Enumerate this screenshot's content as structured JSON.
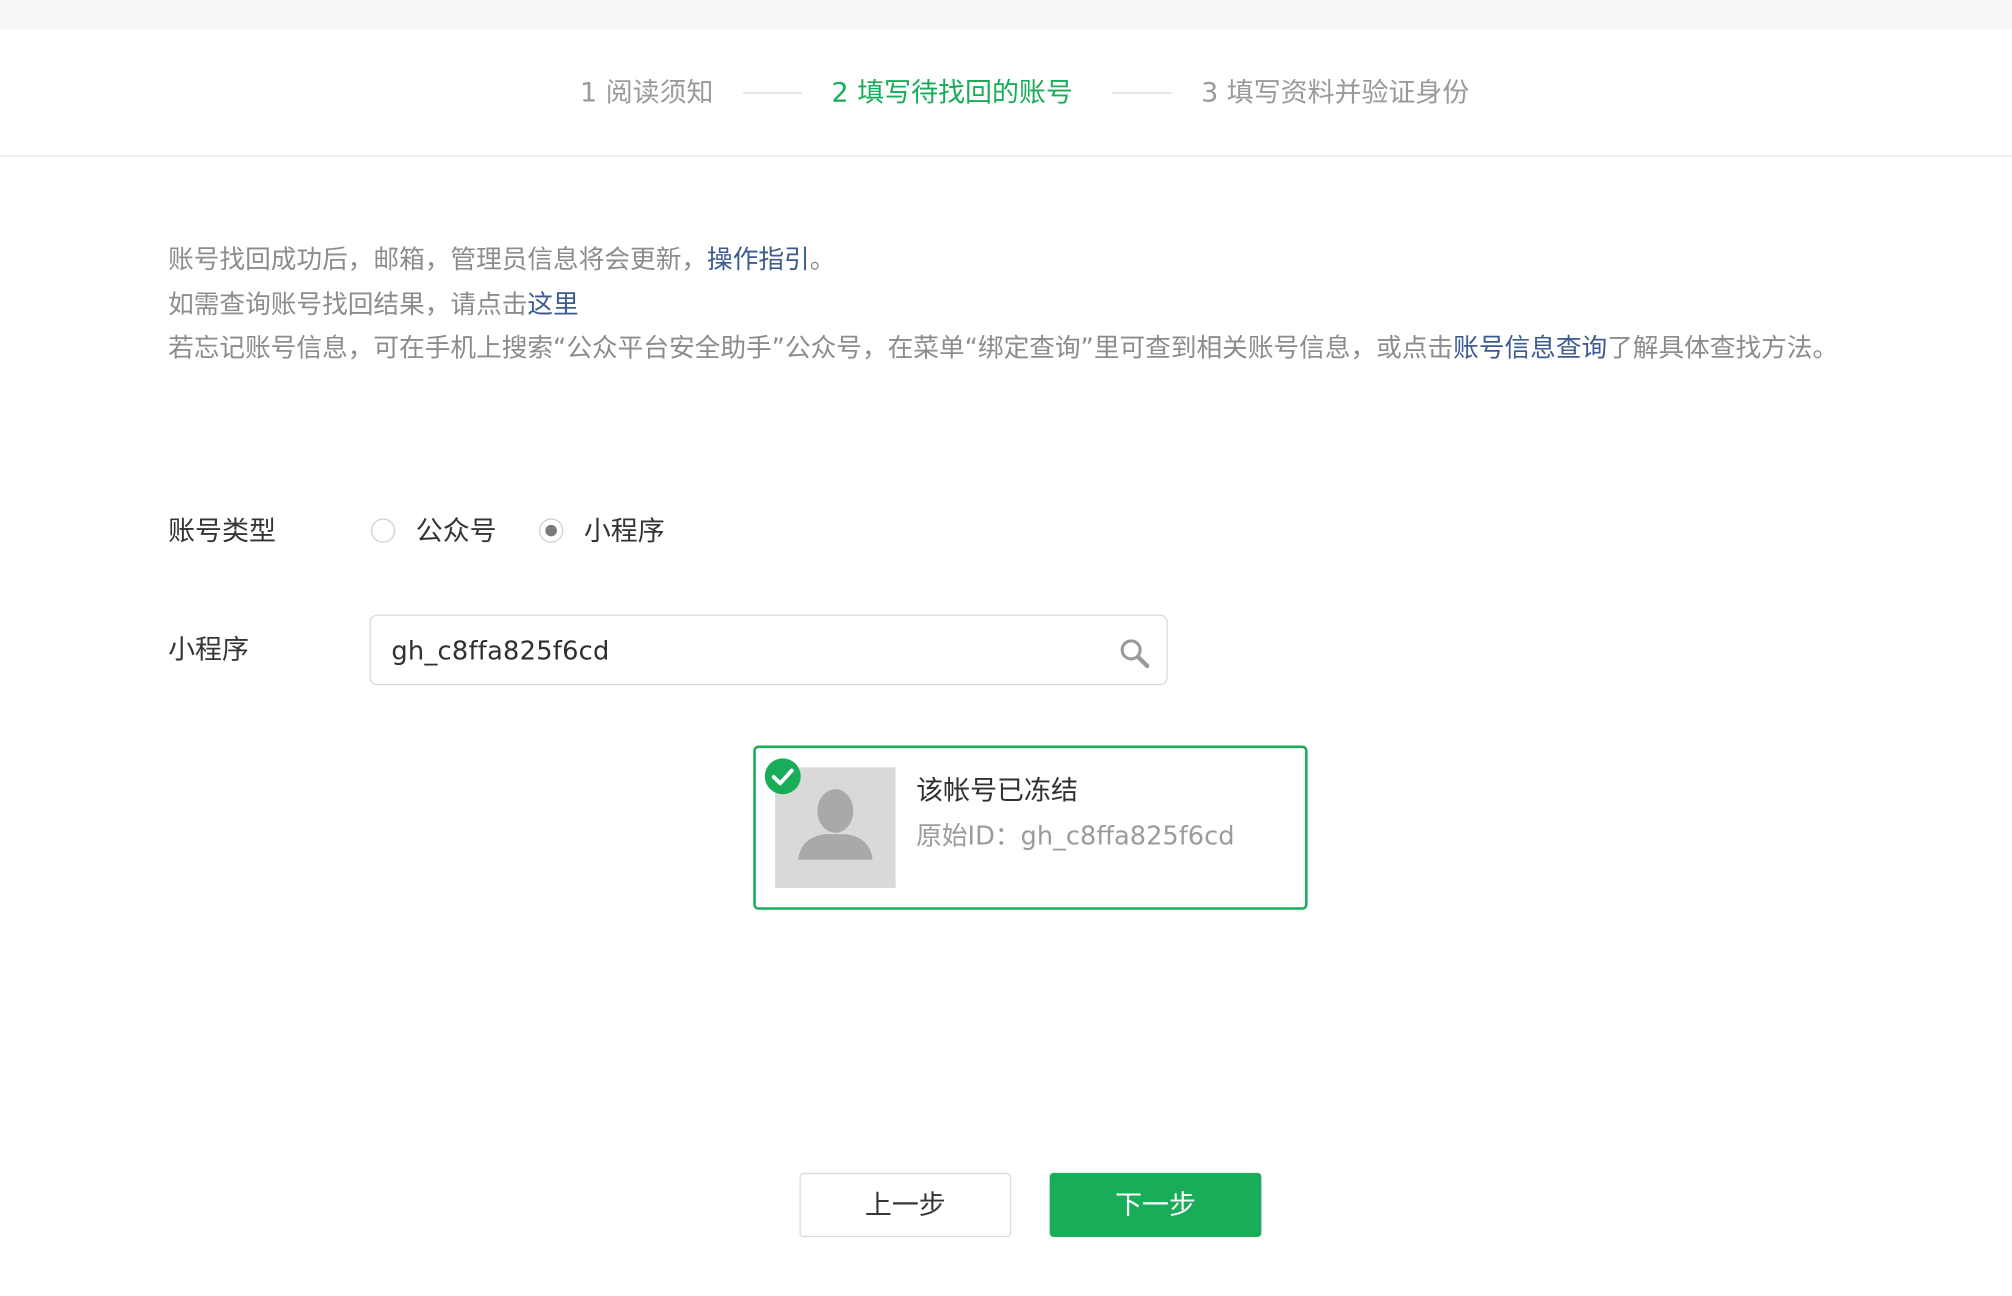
{
  "steps": [
    {
      "label": "1 阅读须知",
      "active": false
    },
    {
      "label": "2 填写待找回的账号",
      "active": true
    },
    {
      "label": "3 填写资料并验证身份",
      "active": false
    }
  ],
  "notice": {
    "line1_text": "账号找回成功后，邮箱，管理员信息将会更新，",
    "line1_link": "操作指引",
    "line1_end": "。",
    "line2_text": "如需查询账号找回结果，请点击",
    "line2_link": "这里",
    "line3_text": "若忘记账号信息，可在手机上搜索“公众平台安全助手”公众号，在菜单“绑定查询”里可查到相关账号信息，或点击",
    "line3_link": "账号信息查询",
    "line3_end": "了解具体查找方法。"
  },
  "form": {
    "account_type_label": "账号类型",
    "options": [
      {
        "label": "公众号",
        "checked": false
      },
      {
        "label": "小程序",
        "checked": true
      }
    ],
    "miniprogram_label": "小程序",
    "search_value": "gh_c8ffa825f6cd"
  },
  "result": {
    "title": "该帐号已冻结",
    "id_prefix": "原始ID：",
    "id_value": "gh_c8ffa825f6cd"
  },
  "buttons": {
    "prev": "上一步",
    "next": "下一步"
  },
  "colors": {
    "accent": "#1aad59",
    "link": "#3e5b8f",
    "muted": "#8c8c8c"
  },
  "icons": [
    "search-icon",
    "check-circle-icon",
    "avatar-placeholder-icon"
  ]
}
